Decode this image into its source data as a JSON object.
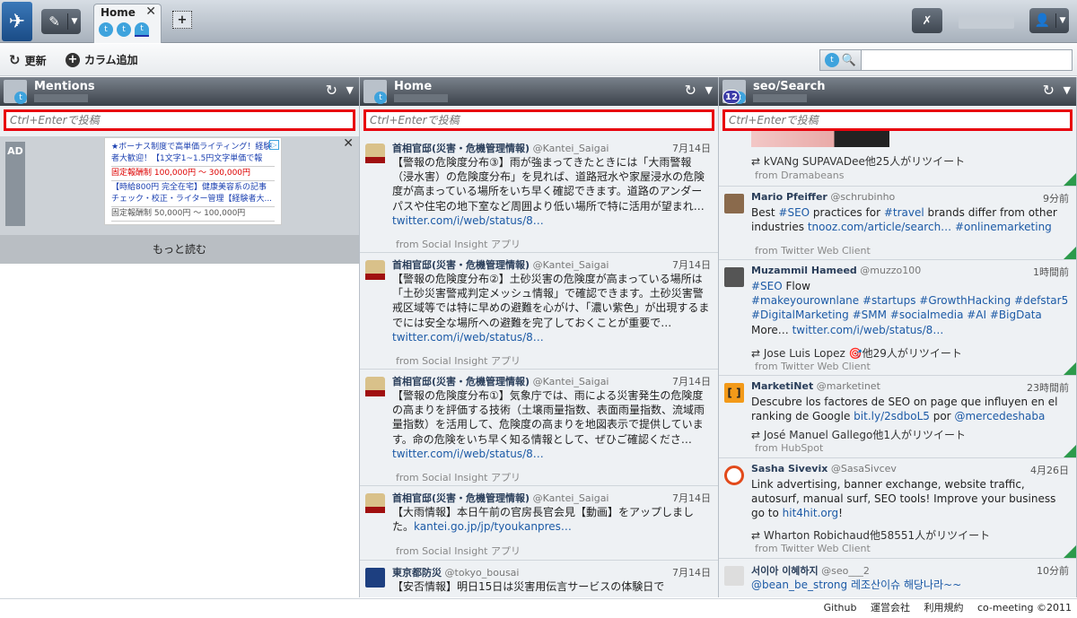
{
  "topbar": {
    "tab_title": "Home",
    "tab_close": "✕",
    "add_tab": "+"
  },
  "toolbar": {
    "refresh_label": "更新",
    "add_column_label": "カラム追加"
  },
  "search": {
    "value": ""
  },
  "composer": {
    "placeholder": "Ctrl+Enterで投稿"
  },
  "columns": [
    {
      "title": "Mentions"
    },
    {
      "title": "Home"
    },
    {
      "title": "seo/Search",
      "badge": "12"
    }
  ],
  "ad": {
    "label": "AD",
    "close": "✕",
    "line1": "★ボーナス制度で高単価ライティング！経験者大歓迎！【1文字1~1.5円文字単価で報",
    "line2": "固定報酬制 100,000円 〜 300,000円",
    "line3": "【時給800円 完全在宅】健康美容系の記事チェック・校正・ライター管理【経験者大...",
    "line4": "固定報酬制 50,000円 〜 100,000円",
    "more": "もっと読む"
  },
  "home_tweets": [
    {
      "name": "首相官邸(災害・危機管理情報)",
      "handle": "@Kantei_Saigai",
      "time": "7月14日",
      "text": "【警報の危険度分布③】雨が強まってきたときには「大雨警報（浸水害）の危険度分布」を見れば、道路冠水や家屋浸水の危険度が高まっている場所をいち早く確認できます。道路のアンダーパスや住宅の地下室など周囲より低い場所で特に活用が望まれ…",
      "link": "twitter.com/i/web/status/8…",
      "from": "from Social Insight アプリ"
    },
    {
      "name": "首相官邸(災害・危機管理情報)",
      "handle": "@Kantei_Saigai",
      "time": "7月14日",
      "text": "【警報の危険度分布②】土砂災害の危険度が高まっている場所は「土砂災害警戒判定メッシュ情報」で確認できます。土砂災害警戒区域等では特に早めの避難を心がけ、「濃い紫色」が出現するまでには安全な場所への避難を完了しておくことが重要で…",
      "link": "twitter.com/i/web/status/8…",
      "from": "from Social Insight アプリ"
    },
    {
      "name": "首相官邸(災害・危機管理情報)",
      "handle": "@Kantei_Saigai",
      "time": "7月14日",
      "text": "【警報の危険度分布①】気象庁では、雨による災害発生の危険度の高まりを評価する技術（土壌雨量指数、表面雨量指数、流域雨量指数）を活用して、危険度の高まりを地図表示で提供しています。命の危険をいち早く知る情報として、ぜひご確認くださ…",
      "link": "twitter.com/i/web/status/8…",
      "from": "from Social Insight アプリ"
    },
    {
      "name": "首相官邸(災害・危機管理情報)",
      "handle": "@Kantei_Saigai",
      "time": "7月14日",
      "text": "【大雨情報】本日午前の官房長官会見【動画】をアップしました。",
      "link": "kantei.go.jp/jp/tyoukanpres…",
      "from": "from Social Insight アプリ"
    },
    {
      "name": "東京都防災",
      "handle": "@tokyo_bousai",
      "time": "7月14日",
      "text": "【安否情報】明日15日は災害用伝言サービスの体験日で",
      "link": "",
      "from": ""
    }
  ],
  "search_tweets": [
    {
      "rt": "kVANg SUPAVADee他25人がリツイート",
      "from": "from Dramabeans"
    },
    {
      "name": "Mario Pfeiffer",
      "handle": "@schrubinho",
      "time": "9分前",
      "text": "Best ",
      "tag1": "#SEO",
      "text2": " practices for ",
      "tag2": "#travel",
      "text3": " brands differ from other industries ",
      "link": "tnooz.com/article/search…",
      "tag3": " #onlinemarketing",
      "from": "from Twitter Web Client"
    },
    {
      "name": "Muzammil Hameed",
      "handle": "@muzzo100",
      "time": "1時間前",
      "line1_tag": "#SEO",
      "line1_text": " Flow",
      "line2": "#makeyourownlane #startups #GrowthHacking #defstar5",
      "line3": "#DigitalMarketing #SMM #socialmedia #AI #BigData",
      "line4_text": "More… ",
      "line4_link": "twitter.com/i/web/status/8…",
      "rt": "Jose Luis Lopez 🎯他29人がリツイート",
      "from": "from Twitter Web Client"
    },
    {
      "name": "MarketiNet",
      "handle": "@marketinet",
      "time": "23時間前",
      "text": "Descubre los factores de SEO on page que influyen en el ranking de Google ",
      "link": "bit.ly/2sdboL5",
      "text2": " por ",
      "mention": "@mercedeshaba",
      "rt": "José Manuel Gallego他1人がリツイート",
      "from": "from HubSpot"
    },
    {
      "name": "Sasha Sivevix",
      "handle": "@SasaSivcev",
      "time": "4月26日",
      "text": "Link advertising, banner exchange, website traffic, autosurf, manual surf, SEO tools! Improve your business go to ",
      "link": "hit4hit.org",
      "text2": "!",
      "rt": "Wharton Robichaud他58551人がリツイート",
      "from": "from Twitter Web Client"
    },
    {
      "name": "서이아 이혜하지",
      "handle": "@seo___2",
      "time": "10分前",
      "text": "@bean_be_strong 레조산이슈 해당나라~~"
    }
  ],
  "footer": {
    "github": "Github",
    "company": "運営会社",
    "terms": "利用規約",
    "copy": "co-meeting ©2011"
  },
  "colors": {
    "accent_red": "#e8000b",
    "twitter_blue": "#3ea3dd",
    "link": "#1c5aa6"
  }
}
